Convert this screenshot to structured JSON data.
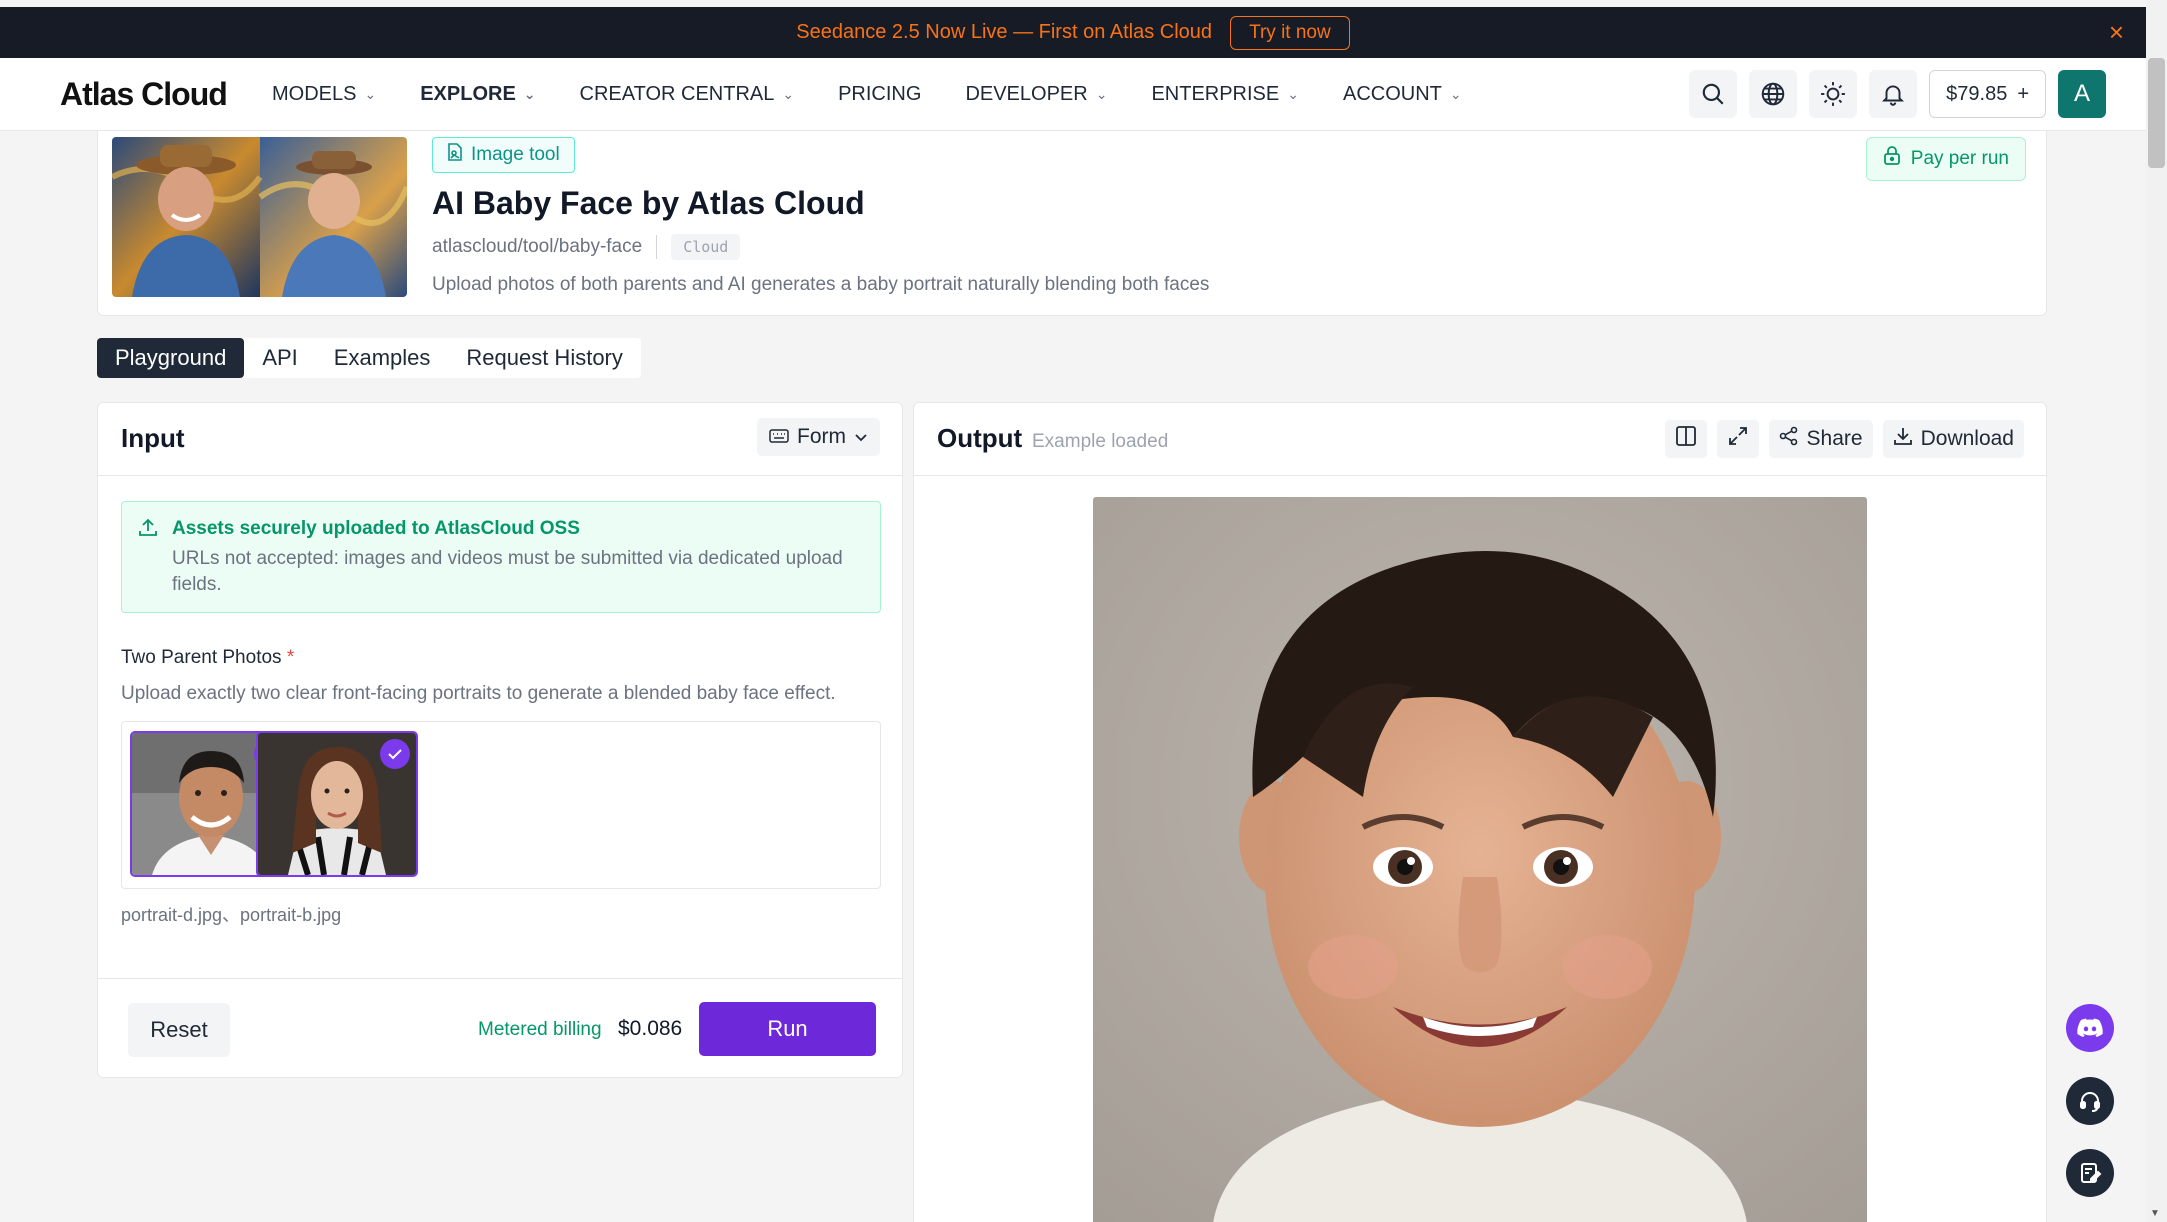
{
  "banner": {
    "text": "Seedance 2.5 Now Live — First on Atlas Cloud",
    "cta": "Try it now",
    "close": "×"
  },
  "nav": {
    "logo": "Atlas Cloud",
    "items": [
      {
        "label": "MODELS",
        "dropdown": true
      },
      {
        "label": "EXPLORE",
        "dropdown": true
      },
      {
        "label": "CREATOR CENTRAL",
        "dropdown": true
      },
      {
        "label": "PRICING",
        "dropdown": false
      },
      {
        "label": "DEVELOPER",
        "dropdown": true
      },
      {
        "label": "ENTERPRISE",
        "dropdown": true
      },
      {
        "label": "ACCOUNT",
        "dropdown": true
      }
    ],
    "balance": "$79.85",
    "balance_add": "+",
    "avatar": "A",
    "icons": [
      "search-icon",
      "globe-icon",
      "sun-icon",
      "bell-icon"
    ]
  },
  "model": {
    "badge": "Image tool",
    "title": "AI Baby Face by Atlas Cloud",
    "slug": "atlascloud/tool/baby-face",
    "tag": "Cloud",
    "description": "Upload photos of both parents and AI generates a baby portrait naturally blending both faces",
    "pricing_badge": "Pay per run"
  },
  "tabs": [
    "Playground",
    "API",
    "Examples",
    "Request History"
  ],
  "input": {
    "title": "Input",
    "mode": "Form",
    "notice_title": "Assets securely uploaded to AtlasCloud OSS",
    "notice_body": "URLs not accepted: images and videos must be submitted via dedicated upload fields.",
    "field_label": "Two Parent Photos",
    "required_mark": "*",
    "field_help": "Upload exactly two clear front-facing portraits to generate a blended baby face effect.",
    "file_names": "portrait-d.jpg、portrait-b.jpg",
    "reset": "Reset",
    "billing_label": "Metered billing",
    "price": "$0.086",
    "run": "Run"
  },
  "output": {
    "title": "Output",
    "status": "Example loaded",
    "share": "Share",
    "download": "Download"
  },
  "colors": {
    "accent": "#6d28d9",
    "success": "#059669",
    "banner_bg": "#161b26",
    "banner_text": "#f97316"
  }
}
